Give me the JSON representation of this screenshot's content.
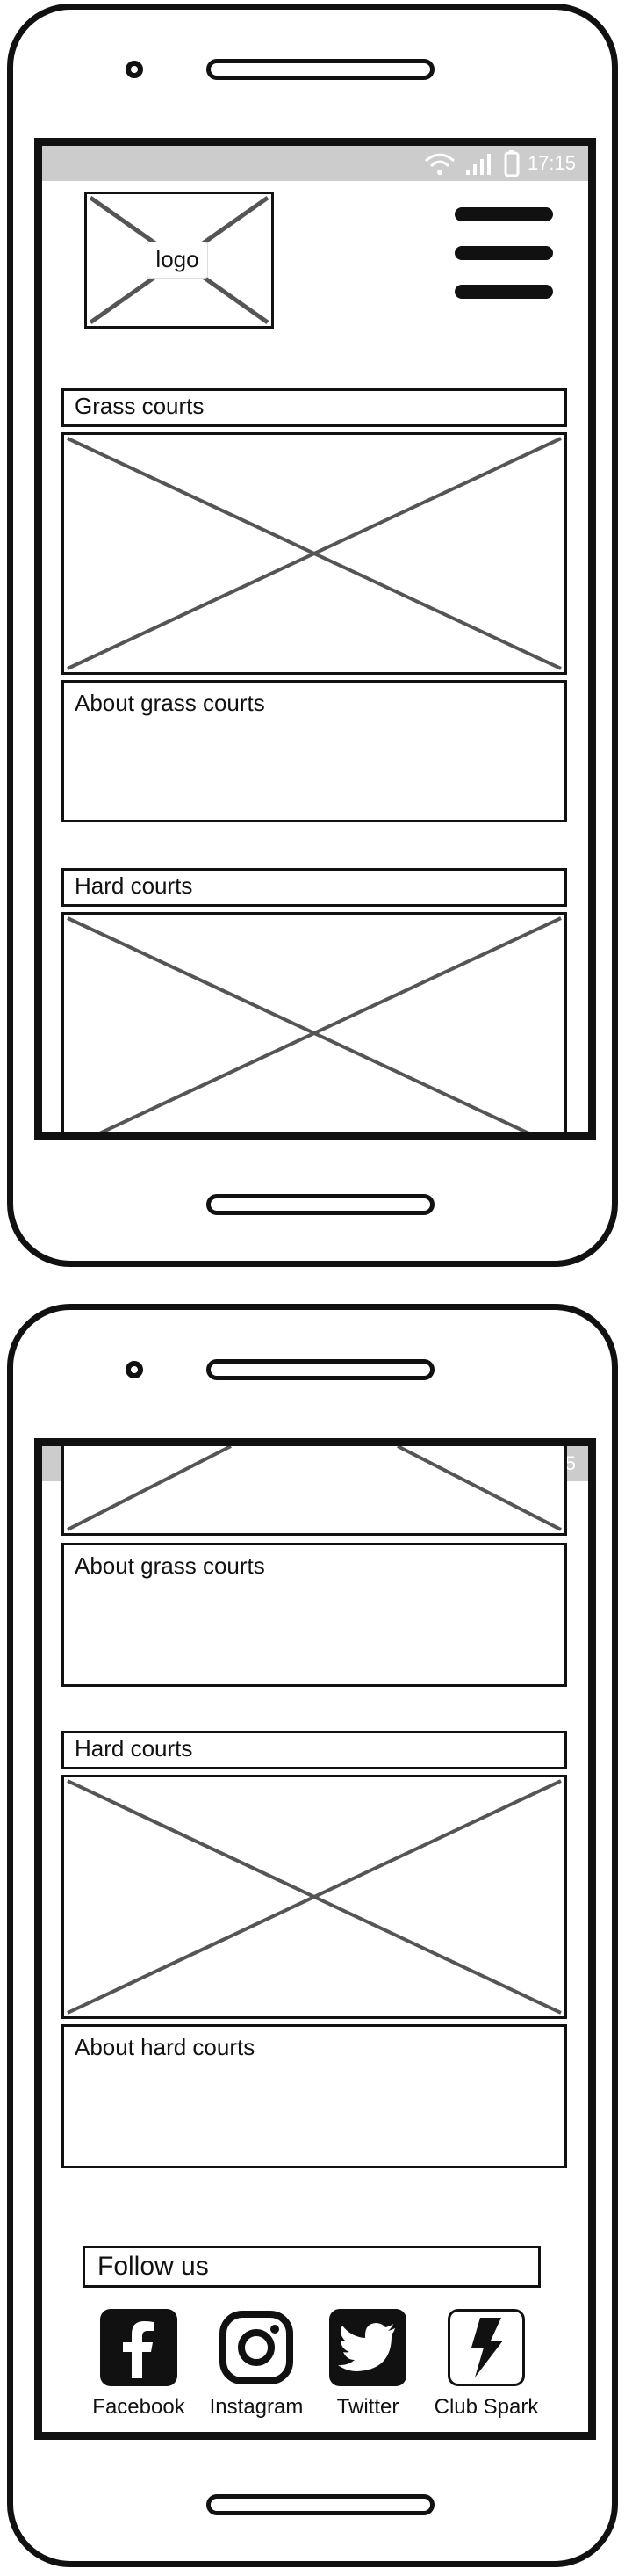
{
  "status": {
    "time": "17:15"
  },
  "screen1": {
    "logo_label": "logo",
    "grass": {
      "title": "Grass courts",
      "about": "About grass courts"
    },
    "hard": {
      "title": "Hard courts"
    }
  },
  "screen2": {
    "grass": {
      "about": "About grass courts"
    },
    "hard": {
      "title": "Hard courts",
      "about": "About hard courts"
    },
    "follow": {
      "title": "Follow us",
      "items": [
        {
          "label": "Facebook",
          "icon": "facebook-icon"
        },
        {
          "label": "Instagram",
          "icon": "instagram-icon"
        },
        {
          "label": "Twitter",
          "icon": "twitter-icon"
        },
        {
          "label": "Club Spark",
          "icon": "lightning-icon"
        }
      ]
    }
  }
}
